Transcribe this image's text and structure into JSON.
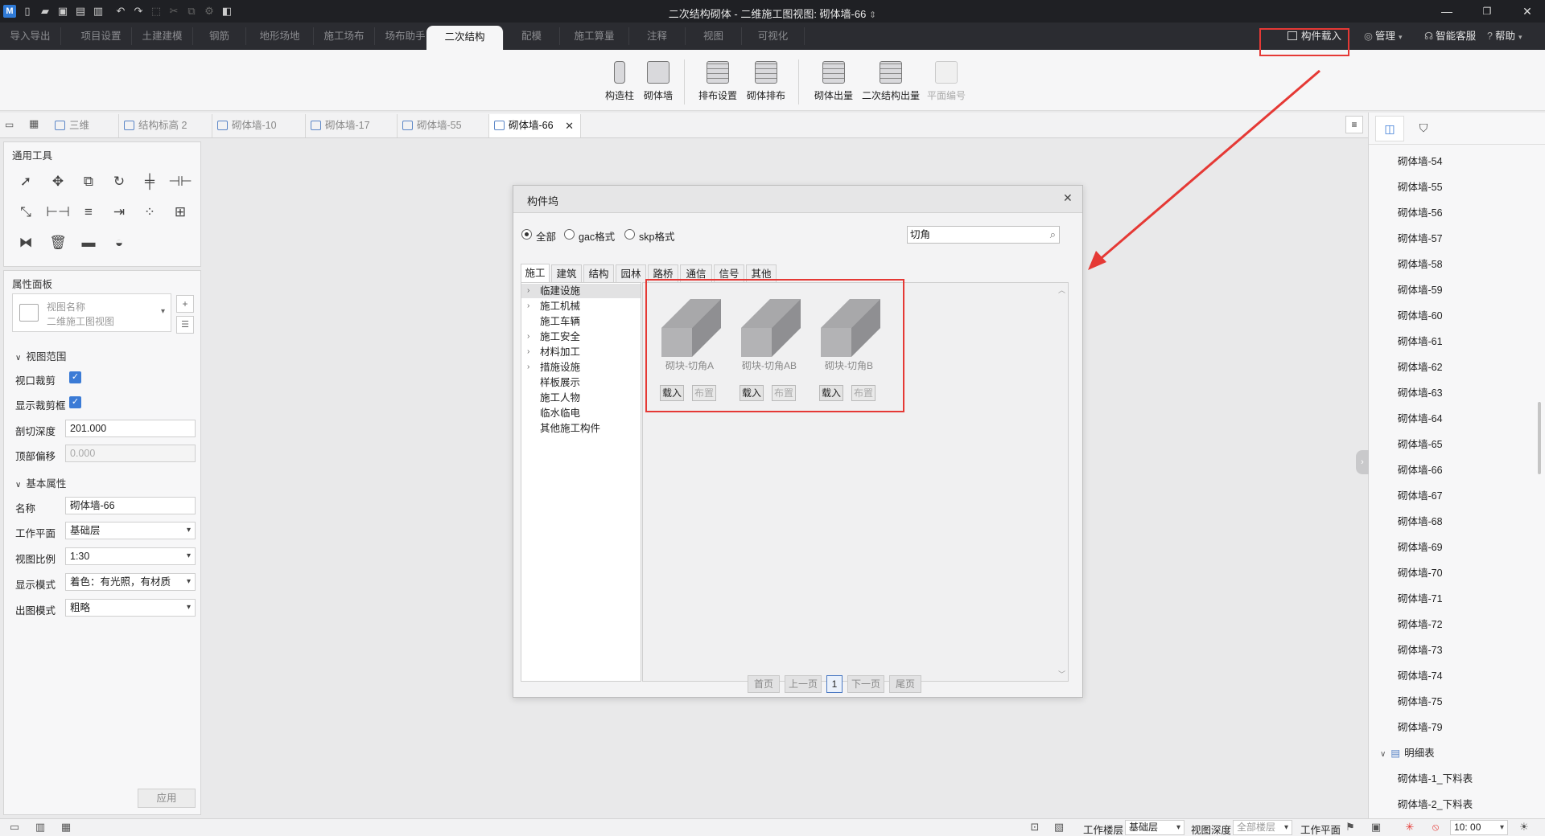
{
  "titlebar": {
    "title": "二次结构砌体 - 二维施工图视图: 砌体墙-66",
    "title_suffix": "⇕",
    "quick_access_icons": [
      "app-logo-icon",
      "new-file-icon",
      "open-folder-icon",
      "save-icon",
      "save-all-icon",
      "export-icon",
      "undo-icon",
      "redo-icon",
      "select-icon",
      "cut-icon",
      "copy-icon",
      "settings-icon",
      "cube-icon"
    ],
    "window_controls": {
      "minimize": "—",
      "restore": "❐",
      "close": "✕"
    }
  },
  "ribbon_tabs": {
    "items": [
      "导入导出",
      "项目设置",
      "土建建模",
      "钢筋",
      "地形场地",
      "施工场布",
      "场布助手",
      "二次结构",
      "配模",
      "施工算量",
      "注释",
      "视图",
      "可视化"
    ],
    "active": "二次结构",
    "right": {
      "component_load": "构件载入",
      "manage": "管理",
      "smart_service": "智能客服",
      "help": "帮助"
    }
  },
  "ribbon": {
    "groups": [
      {
        "buttons": [
          "构造柱",
          "砌体墙"
        ]
      },
      {
        "buttons": [
          "排布设置",
          "砌体排布"
        ]
      },
      {
        "buttons": [
          "砌体出量",
          "二次结构出量",
          "平面编号"
        ]
      }
    ],
    "disabled": [
      "平面编号"
    ]
  },
  "doc_tabs": {
    "items": [
      "三维",
      "结构标高 2",
      "砌体墙-10",
      "砌体墙-17",
      "砌体墙-55",
      "砌体墙-66"
    ],
    "active": "砌体墙-66",
    "close": "✕",
    "menu": "≡"
  },
  "tools_panel": {
    "title": "通用工具"
  },
  "props_panel": {
    "title": "属性面板",
    "view_name_label": "视图名称",
    "view_name_value": "二维施工图视图",
    "section_view_range": "视图范围",
    "viewport_crop_label": "视口裁剪",
    "show_crop_label": "显示裁剪框",
    "cut_depth_label": "剖切深度",
    "cut_depth_value": "201.000",
    "top_offset_label": "顶部偏移",
    "top_offset_value": "0.000",
    "section_basic": "基本属性",
    "name_label": "名称",
    "name_value": "砌体墙-66",
    "work_plane_label": "工作平面",
    "work_plane_value": "基础层",
    "view_scale_label": "视图比例",
    "view_scale_value": "1:30",
    "display_mode_label": "显示模式",
    "display_mode_value": "着色：有光照，有材质",
    "output_mode_label": "出图模式",
    "output_mode_value": "粗略",
    "apply": "应用"
  },
  "dialog": {
    "title": "构件坞",
    "radios": [
      "全部",
      "gac格式",
      "skp格式"
    ],
    "radio_selected": "全部",
    "search_value": "切角",
    "category_tabs": [
      "施工",
      "建筑",
      "结构",
      "园林",
      "路桥",
      "通信",
      "信号",
      "其他"
    ],
    "active_category": "施工",
    "tree": [
      {
        "label": "临建设施",
        "expandable": true,
        "selected": true
      },
      {
        "label": "施工机械",
        "expandable": true
      },
      {
        "label": "施工车辆",
        "expandable": false
      },
      {
        "label": "施工安全",
        "expandable": true
      },
      {
        "label": "材料加工",
        "expandable": true
      },
      {
        "label": "措施设施",
        "expandable": true
      },
      {
        "label": "样板展示",
        "expandable": false
      },
      {
        "label": "施工人物",
        "expandable": false
      },
      {
        "label": "临水临电",
        "expandable": false
      },
      {
        "label": "其他施工构件",
        "expandable": false
      }
    ],
    "cards": [
      {
        "label": "砌块-切角A",
        "load": "载入",
        "place": "布置"
      },
      {
        "label": "砌块-切角AB",
        "load": "载入",
        "place": "布置"
      },
      {
        "label": "砌块-切角B",
        "load": "载入",
        "place": "布置"
      }
    ],
    "pagination": {
      "first": "首页",
      "prev": "上一页",
      "current": "1",
      "next": "下一页",
      "last": "尾页"
    }
  },
  "right_panel": {
    "items": [
      "砌体墙-54",
      "砌体墙-55",
      "砌体墙-56",
      "砌体墙-57",
      "砌体墙-58",
      "砌体墙-59",
      "砌体墙-60",
      "砌体墙-61",
      "砌体墙-62",
      "砌体墙-63",
      "砌体墙-64",
      "砌体墙-65",
      "砌体墙-66",
      "砌体墙-67",
      "砌体墙-68",
      "砌体墙-69",
      "砌体墙-70",
      "砌体墙-71",
      "砌体墙-72",
      "砌体墙-73",
      "砌体墙-74",
      "砌体墙-75",
      "砌体墙-79"
    ],
    "group_label": "明细表",
    "group_items": [
      "砌体墙-1_下料表",
      "砌体墙-2_下料表"
    ]
  },
  "statusbar": {
    "work_floor_label": "工作楼层",
    "work_floor_value": "基础层",
    "view_depth_label": "视图深度",
    "view_depth_value": "全部楼层",
    "work_plane_label": "工作平面",
    "time_value": "10: 00"
  },
  "colors": {
    "accent": "#3b7bd6",
    "annotation": "#e53935",
    "titlebar": "#1f2024"
  }
}
